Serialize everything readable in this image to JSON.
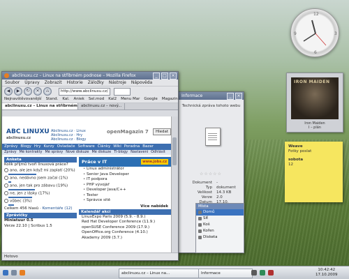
{
  "browser": {
    "title": "abclinuxu.cz – Linux na stříbrném podnose – Mozilla Firefox",
    "menu": [
      "Soubor",
      "Úpravy",
      "Zobrazit",
      "Historie",
      "Záložky",
      "Nástroje",
      "Nápověda"
    ],
    "url": "http://www.abclinuxu.cz/",
    "bookmarks": [
      "Nejnavštěvovanější",
      "Stand.",
      "Kal.",
      "Aniek",
      "Sel.mod",
      "Kal2",
      "Menu Mar",
      "Google",
      "Magazine"
    ],
    "tabs": [
      "abclinuxu.cz – Linux na stříbrném podnose",
      "abclinuxu.cz – nový..."
    ],
    "status": "Hotovo"
  },
  "site": {
    "logo": "ABC LINUXU",
    "logo_sub": "abclinuxu.cz",
    "banner": "openMagazin 7",
    "banner_btn": "Hledat",
    "nav": [
      "Zprávy",
      "Blogy",
      "Hry",
      "Kurzy",
      "Ovladače",
      "Software",
      "Články",
      "Wiki",
      "Poradna",
      "Bazar"
    ],
    "nav2": [
      "Zprávy",
      "Mé kontrakty",
      "Mé správy",
      "Nové diskuze",
      "Mé diskuze",
      "Ti-blogy",
      "Nastavení",
      "Odhlásit"
    ],
    "poll_title": "Anketa",
    "poll_question": "Kolik příjmů tvoří linuxová práce?",
    "poll_options": [
      "ano, ale jen když mi zaplatí (20%)",
      "ano, nedávno jsem začal (1%)",
      "ano, jen tak pro zábavu (19%)",
      "ne, jen z lásky (17%)",
      "vůbec (3%)"
    ],
    "poll_total": "Celkem 456 hlasů",
    "poll_link": "Komentáře (12)",
    "section_title": "Zprávičky",
    "release": "Miniatuur 0.5",
    "release_info": "Verze 22.10 | Scribus 1.5",
    "jobs_title": "Práce v IT",
    "jobs_logo": "www.jobs.cz",
    "jobs": [
      "Linux administrátor",
      "Senior Java Developer",
      "IT podpora",
      "PHP vývojář",
      "Developer Java/C++",
      "Tester",
      "Správce sítě"
    ],
    "jobs_more": "Více nabídek",
    "calendar_title": "Kalendář akcí",
    "events": [
      "LinuxExpo Paris 2009 (5.9. - 8.9.)",
      "Red Hat Developer Conference (11.9.)",
      "openSUSE Conference 2009 (17.9.)",
      "OpenOffice.org Conference (4.10.)",
      "Akademy 2009 (3.7.)"
    ]
  },
  "window2": {
    "title": "Informace",
    "heading": "Technická zpráva tohoto webu",
    "rating": "☆☆☆☆☆",
    "fields": [
      "Dokument",
      "Typ",
      "Velikost",
      "Verze",
      "Datum"
    ],
    "values": [
      "-",
      "dokument",
      "14.3 KB",
      "2.0",
      "17.10."
    ],
    "panel_title": "Místa",
    "places": [
      "Domů",
      "Síť",
      "Koš",
      "Kořen",
      "Disketa"
    ]
  },
  "widgets": {
    "clock_numbers": [
      "12",
      "3",
      "6",
      "9"
    ],
    "album_band": "IRON MAIDEN",
    "album_caption": "Iron Maiden\nI – plán",
    "note_lines_1": [
      "Weave",
      "Fotky poslat"
    ],
    "note_lines_2": [
      "sobota",
      "12"
    ]
  },
  "taskbar": {
    "items": [
      "abclinuxu.cz – Linux na...",
      "Informace"
    ],
    "time": "10:42:42",
    "date": "17.10.2009"
  }
}
